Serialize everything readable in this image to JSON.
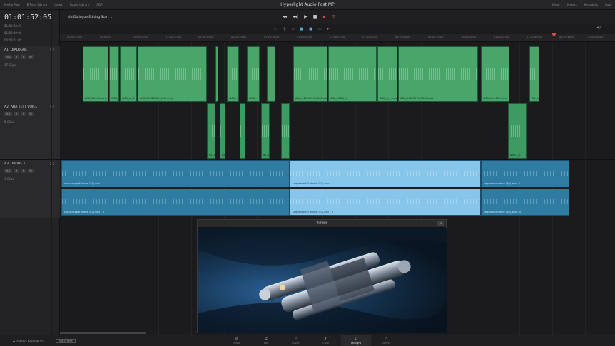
{
  "window": {
    "title": "Hyperlight Audio Post MP",
    "left_items": [
      "Media Pool",
      "Effects Library",
      "Index",
      "Sound Library",
      "ADR"
    ],
    "right_items": [
      "Mixer",
      "Meters",
      "Metadata",
      "Insp"
    ]
  },
  "timecode": {
    "current": "01:01:52:05",
    "rows": [
      "01:00:00:03",
      "01:00:00:00",
      "00:00:01:05"
    ]
  },
  "timeline_menu": {
    "selected": "4a Dialogue Editing Start"
  },
  "transport": [
    "◂◂",
    "◂◂|",
    "▶",
    "■",
    "▪",
    "⟲"
  ],
  "editor_tools": [
    "↖",
    "·|·",
    "⦸",
    "■",
    "■",
    "▭",
    "▸"
  ],
  "ruler_ticks": [
    "00:59:52:00",
    "00:58:00",
    "01:00:04:00",
    "01:00:12:00",
    "01:00:20:00",
    "01:00:28:00",
    "01:00:36:00",
    "01:00:44:00",
    "01:00:52:00",
    "01:01:00:00",
    "01:01:08:00",
    "01:01:16:00",
    "01:01:24:00",
    "01:01:32:00",
    "01:01:40:00",
    "01:01:48:00",
    "01:01:56:00"
  ],
  "tracks": [
    {
      "id": "A1",
      "name": "DIALOGUE",
      "volume": "1.0",
      "clips_label": "17 Clips",
      "btns": [
        "R",
        "S",
        "M"
      ],
      "level": "+0.0"
    },
    {
      "id": "A2",
      "name": "ADA TEST VOICE",
      "volume": "1.0",
      "clips_label": "5 Clips",
      "btns": [
        "R",
        "S",
        "M"
      ],
      "level": "0.0"
    },
    {
      "id": "A3",
      "name": "DRONE 1",
      "volume": "2.0",
      "clips_label": "3 Clips",
      "btns": [
        "R",
        "S",
        "M"
      ],
      "level": "0.0"
    }
  ],
  "dialogue_clips": [
    "AMB_01...Ki.mov_1",
    "AMB_...",
    "AMB_ov_1",
    "AMB_01120110_0001.mov",
    "AMB_..",
    "AMB_...",
    "ADA_01020020_0001.mov",
    "ADA_0102(..)",
    "AMB_8_...mov",
    "ADA_01020070_0001.mov",
    "AMB_03...007.mov",
    "AM_sw"
  ],
  "vo_clips": [
    "ou_1",
    "ou_",
    "ou_1",
    "AAA..._1"
  ],
  "drone_clips_left": [
    "sequencepdf drone 1(0).wav - L",
    "sequencepdf drone 1(0).wav - R"
  ],
  "drone_clips_mid": [
    "sequence fx5 drone 1(0).wav - L",
    "sequence fx5 drone 1(0).wav - R"
  ],
  "drone_clips_right": [
    "seqaerohd drone 1(0).wav - L",
    "seqaerohd drone 1(0).wav - R"
  ],
  "viewer": {
    "title": "Viewer"
  },
  "footer": {
    "app": "DaVinci Resolve 15",
    "badge": "PUBLIC BETA",
    "pages": [
      {
        "label": "Media",
        "icon": "▦"
      },
      {
        "label": "Edit",
        "icon": "⧉"
      },
      {
        "label": "Fusion",
        "icon": "✧"
      },
      {
        "label": "Color",
        "icon": "◐"
      },
      {
        "label": "Fairlight",
        "icon": "♫"
      },
      {
        "label": "Deliver",
        "icon": "↗"
      }
    ]
  }
}
